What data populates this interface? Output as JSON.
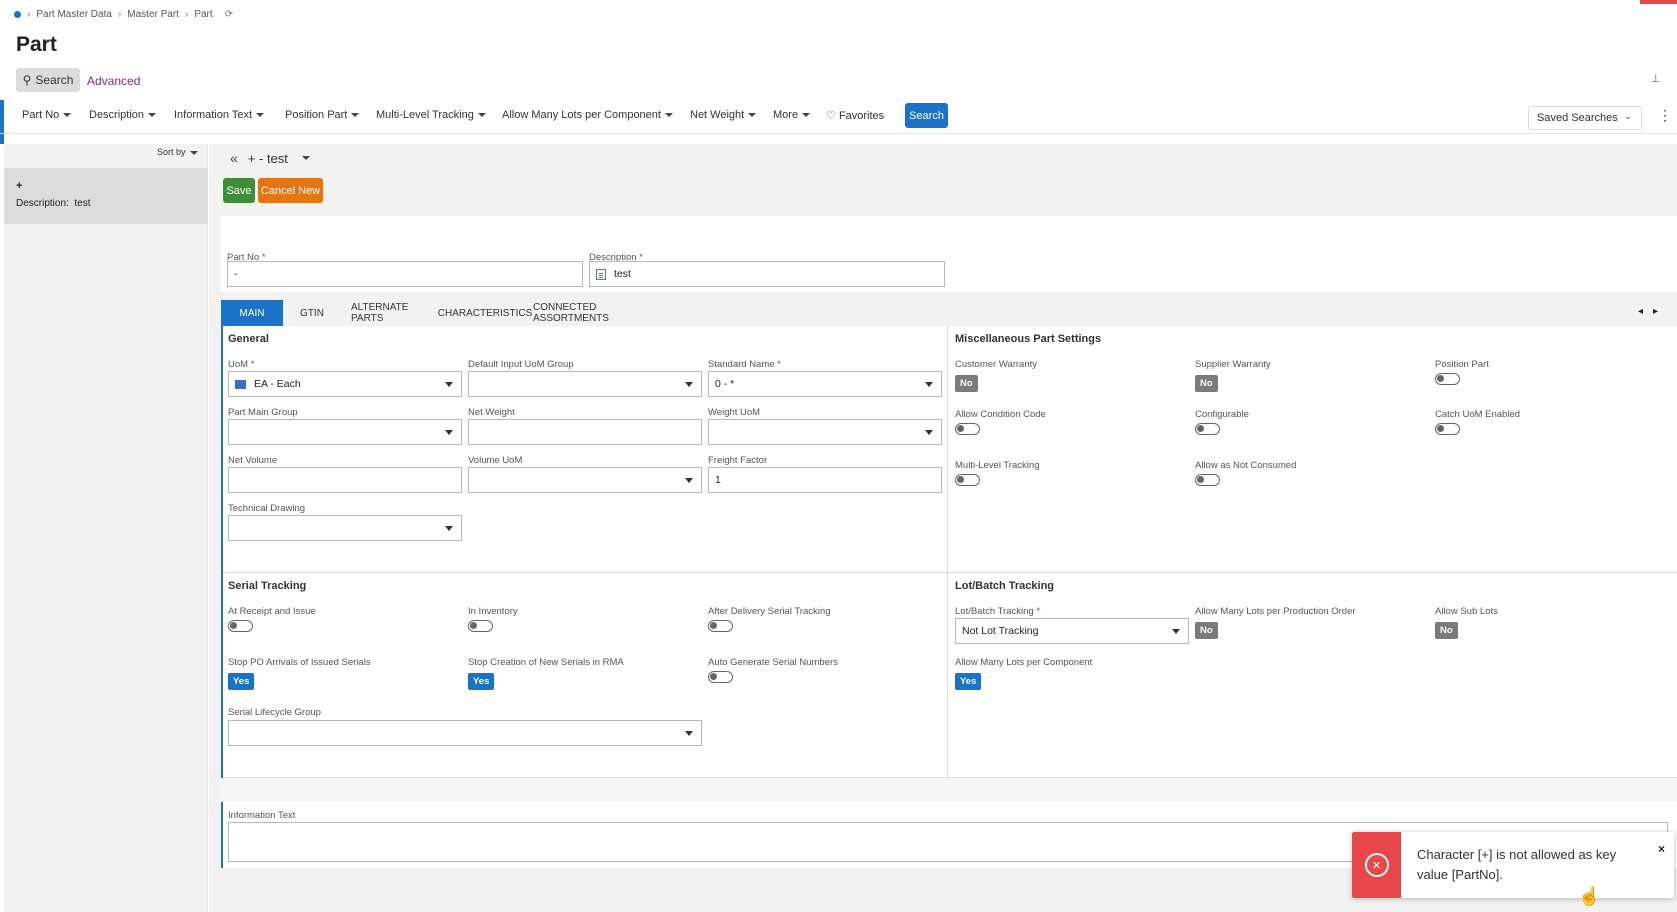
{
  "breadcrumb": [
    "Part Master Data",
    "Master Part",
    "Part"
  ],
  "page_title": "Part",
  "search_chip": "Search",
  "advanced_link": "Advanced",
  "filters": [
    "Part No",
    "Description",
    "Information Text",
    "Position Part",
    "Multi-Level Tracking",
    "Allow Many Lots per Component",
    "Net Weight",
    "More"
  ],
  "favorites": "Favorites",
  "search_button": "Search",
  "saved_searches": "Saved Searches",
  "sort_by": "Sort by",
  "list_item": {
    "title": "+",
    "desc_label": "Description:",
    "desc_value": "test"
  },
  "record_title": "+ - test",
  "save_button": "Save",
  "cancel_button": "Cancel New",
  "header": {
    "part_no_label": "Part No",
    "part_no_value": "-",
    "description_label": "Description",
    "description_value": "test"
  },
  "tabs": [
    "MAIN",
    "GTIN",
    "ALTERNATE PARTS",
    "CHARACTERISTICS",
    "CONNECTED ASSORTMENTS"
  ],
  "general": {
    "title": "General",
    "uom_label": "UoM",
    "uom_value": "EA - Each",
    "default_input_uom_group_label": "Default Input UoM Group",
    "standard_name_label": "Standard Name",
    "standard_name_value": "0 - *",
    "part_main_group_label": "Part Main Group",
    "net_weight_label": "Net Weight",
    "weight_uom_label": "Weight UoM",
    "net_volume_label": "Net Volume",
    "volume_uom_label": "Volume UoM",
    "freight_factor_label": "Freight Factor",
    "freight_factor_value": "1",
    "technical_drawing_label": "Technical Drawing"
  },
  "misc": {
    "title": "Miscellaneous Part Settings",
    "customer_warranty": "Customer Warranty",
    "customer_warranty_value": "No",
    "supplier_warranty": "Supplier Warranty",
    "supplier_warranty_value": "No",
    "position_part": "Position Part",
    "allow_condition_code": "Allow Condition Code",
    "configurable": "Configurable",
    "catch_uom_enabled": "Catch UoM Enabled",
    "multi_level_tracking": "Multi-Level Tracking",
    "allow_as_not_consumed": "Allow as Not Consumed"
  },
  "serial": {
    "title": "Serial Tracking",
    "at_receipt_and_issue": "At Receipt and Issue",
    "in_inventory": "In Inventory",
    "after_delivery": "After Delivery Serial Tracking",
    "stop_po_arrivals": "Stop PO Arrivals of Issued Serials",
    "stop_po_arrivals_value": "Yes",
    "stop_creation_rma": "Stop Creation of New Serials in RMA",
    "stop_creation_rma_value": "Yes",
    "auto_generate": "Auto Generate Serial Numbers",
    "lifecycle_group": "Serial Lifecycle Group"
  },
  "lot": {
    "title": "Lot/Batch Tracking",
    "tracking_label": "Lot/Batch Tracking",
    "tracking_value": "Not Lot Tracking",
    "many_lots_prod_order": "Allow Many Lots per Production Order",
    "many_lots_prod_order_value": "No",
    "allow_sub_lots": "Allow Sub Lots",
    "allow_sub_lots_value": "No",
    "many_lots_component": "Allow Many Lots per Component",
    "many_lots_component_value": "Yes"
  },
  "information_text_label": "Information Text",
  "toast": {
    "message": "Character [+] is not allowed as key value [PartNo].",
    "close": "×"
  },
  "colors": {
    "accent": "#1a73c9",
    "save": "#3e8e35",
    "cancel": "#e6740f",
    "error": "#e8484a"
  }
}
